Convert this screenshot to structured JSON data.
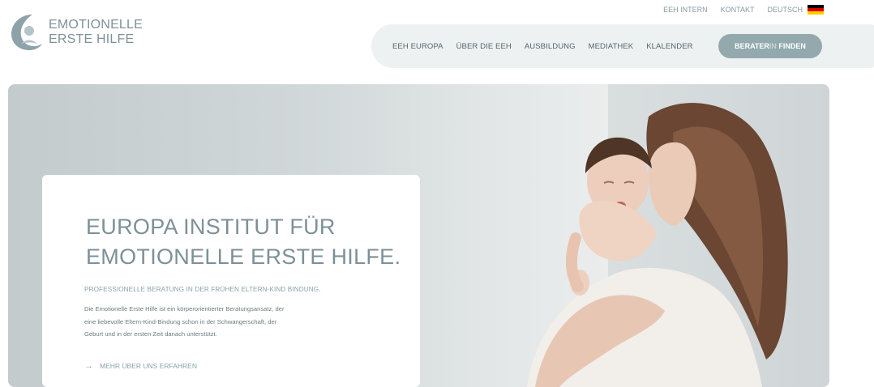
{
  "logo": {
    "line1": "EMOTIONELLE",
    "line2": "ERSTE HILFE"
  },
  "topnav": [
    {
      "label": "EEH INTERN"
    },
    {
      "label": "KONTAKT"
    },
    {
      "label": "DEUTSCH"
    }
  ],
  "nav": {
    "items": [
      {
        "label": "EEH EUROPA"
      },
      {
        "label": "ÜBER DIE EEH"
      },
      {
        "label": "AUSBILDUNG"
      },
      {
        "label": "MEDIATHEK"
      },
      {
        "label": "KLALENDER"
      }
    ],
    "cta": {
      "part1": "BERATER",
      "part2": "IN",
      "part3": " FINDEN"
    }
  },
  "hero": {
    "title_line1": "EUROPA INSTITUT FÜR",
    "title_line2": "EMOTIONELLE ERSTE HILFE.",
    "subtitle": "PROFESSIONELLE BERATUNG IN DER FRÜHEN ELTERN-KIND BINDUNG.",
    "body_line1": "Die Emotionelle Erste Hilfe ist ein körperorientierter Beratungsansatz, der",
    "body_line2": "eine liebevolle Eltern-Kind-Bindung schon in der Schwangerschaft, der",
    "body_line3": "Geburt und in der ersten Zeit danach unterstützt.",
    "more_label": "MEHR ÜBER UNS ERFAHREN"
  },
  "colors": {
    "accent": "#93a9ae",
    "text": "#7d9097",
    "flag": [
      "#000000",
      "#dd0000",
      "#ffce00"
    ]
  }
}
